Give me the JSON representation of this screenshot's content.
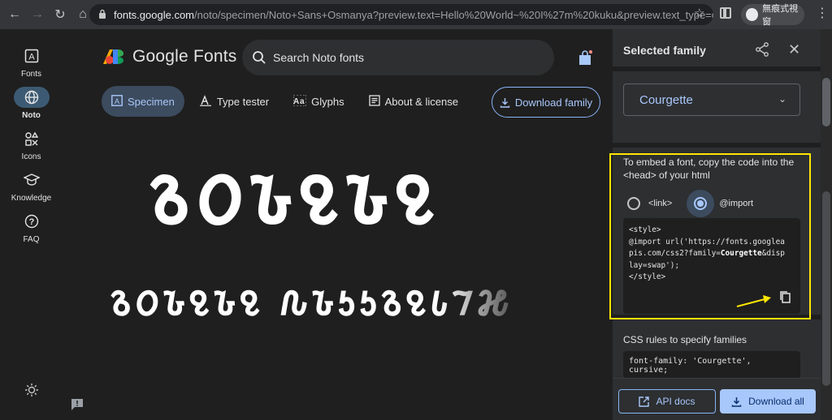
{
  "browser": {
    "url_host": "fonts.google.com",
    "url_path": "/noto/specimen/Noto+Sans+Osmanya?preview.text=Hello%20World~%20I%27m%20kuku&preview.text_type=cu...",
    "profile_label": "無痕式視窗"
  },
  "rail": {
    "items": [
      {
        "label": "Fonts",
        "icon": "fonts-icon"
      },
      {
        "label": "Noto",
        "icon": "globe-icon"
      },
      {
        "label": "Icons",
        "icon": "shapes-icon"
      },
      {
        "label": "Knowledge",
        "icon": "graduation-cap-icon"
      },
      {
        "label": "FAQ",
        "icon": "help-icon"
      }
    ],
    "theme_icon": "brightness-icon"
  },
  "header": {
    "logo_text": "Google Fonts",
    "search_placeholder": "Search Noto fonts"
  },
  "tabs": [
    {
      "label": "Specimen",
      "active": true
    },
    {
      "label": "Type tester",
      "active": false
    },
    {
      "label": "Glyphs",
      "active": false
    },
    {
      "label": "About & license",
      "active": false
    }
  ],
  "download_family_label": "Download family",
  "preview": {
    "line1": "𐒈𐒆𐒊𐒉𐒊𐒉",
    "line2": "𐒈𐒆𐒊𐒉𐒊𐒉 𐒐𐒊𐒑𐒑𐒈𐒉𐒗𐒇𐒎"
  },
  "side_panel": {
    "title": "Selected family",
    "selected_family": "Courgette",
    "embed_text": "To embed a font, copy the code into the <head> of your html",
    "radio_link": "<link>",
    "radio_import": "@import",
    "code_lines": [
      "<style>",
      "@import url('https://fonts.googlea",
      "pis.com/css2?family=",
      "Courgette",
      "&disp",
      "lay=swap');",
      "</style>"
    ],
    "css_title": "CSS rules to specify families",
    "css_code": "font-family: 'Courgette', cursive;",
    "api_docs_label": "API docs",
    "download_all_label": "Download all"
  },
  "colors": {
    "accent": "#a8c7fa",
    "highlight": "#ffe500"
  }
}
